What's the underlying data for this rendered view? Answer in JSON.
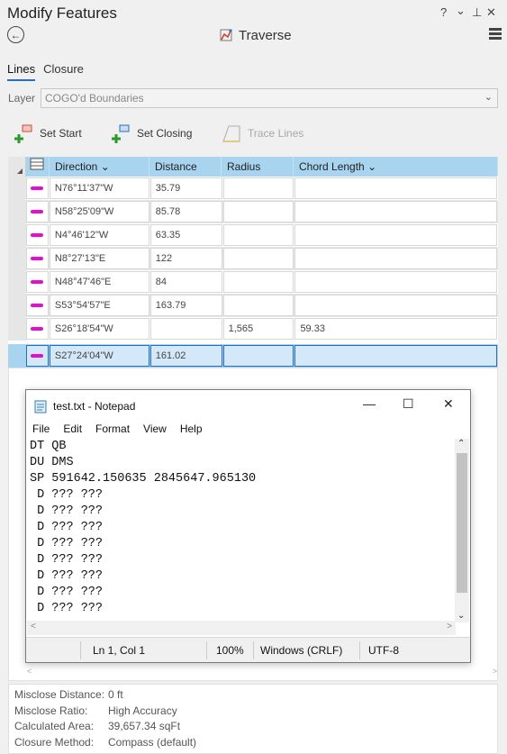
{
  "pane": {
    "title": "Modify Features",
    "help": "?",
    "menu_arrow": "⌄",
    "pin": "⊥",
    "close": "✕"
  },
  "tool": {
    "title": "Traverse"
  },
  "tabs": [
    {
      "label": "Lines"
    },
    {
      "label": "Closure"
    }
  ],
  "layer": {
    "label": "Layer",
    "value": "COGO'd Boundaries"
  },
  "toolbar": {
    "set_start": "Set Start",
    "set_closing": "Set Closing",
    "trace_lines": "Trace Lines"
  },
  "grid": {
    "columns": {
      "direction": "Direction",
      "distance": "Distance",
      "radius": "Radius",
      "chord_length": "Chord Length"
    },
    "rows": [
      {
        "direction": "N76°11'37\"W",
        "distance": "35.79",
        "radius": "",
        "chord": ""
      },
      {
        "direction": "N58°25'09\"W",
        "distance": "85.78",
        "radius": "",
        "chord": ""
      },
      {
        "direction": "N4°46'12\"W",
        "distance": "63.35",
        "radius": "",
        "chord": ""
      },
      {
        "direction": "N8°27'13\"E",
        "distance": "122",
        "radius": "",
        "chord": ""
      },
      {
        "direction": "N48°47'46\"E",
        "distance": "84",
        "radius": "",
        "chord": ""
      },
      {
        "direction": "S53°54'57\"E",
        "distance": "163.79",
        "radius": "",
        "chord": ""
      },
      {
        "direction": "S26°18'54\"W",
        "distance": "",
        "radius": "1,565",
        "chord": "59.33"
      },
      {
        "direction": "S27°24'04\"W",
        "distance": "161.02",
        "radius": "",
        "chord": ""
      }
    ]
  },
  "notepad": {
    "title": "test.txt - Notepad",
    "menu": [
      "File",
      "Edit",
      "Format",
      "View",
      "Help"
    ],
    "content": "DT QB\nDU DMS\nSP 591642.150635 2845647.965130\n D ??? ???\n D ??? ???\n D ??? ???\n D ??? ???\n D ??? ???\n D ??? ???\n D ??? ???\n D ??? ???",
    "status": {
      "position": "Ln 1, Col 1",
      "zoom": "100%",
      "line_ending": "Windows (CRLF)",
      "encoding": "UTF-8"
    }
  },
  "info": [
    {
      "key": "Misclose Distance:",
      "value": "0 ft"
    },
    {
      "key": "Misclose Ratio:",
      "value": "High Accuracy"
    },
    {
      "key": "Calculated Area:",
      "value": "39,657.34 sqFt"
    },
    {
      "key": "Closure Method:",
      "value": "Compass (default)"
    }
  ],
  "colors": {
    "accent": "#2a6ebb",
    "header_blue": "#a8d4f0",
    "line_marker": "#e010d0"
  }
}
